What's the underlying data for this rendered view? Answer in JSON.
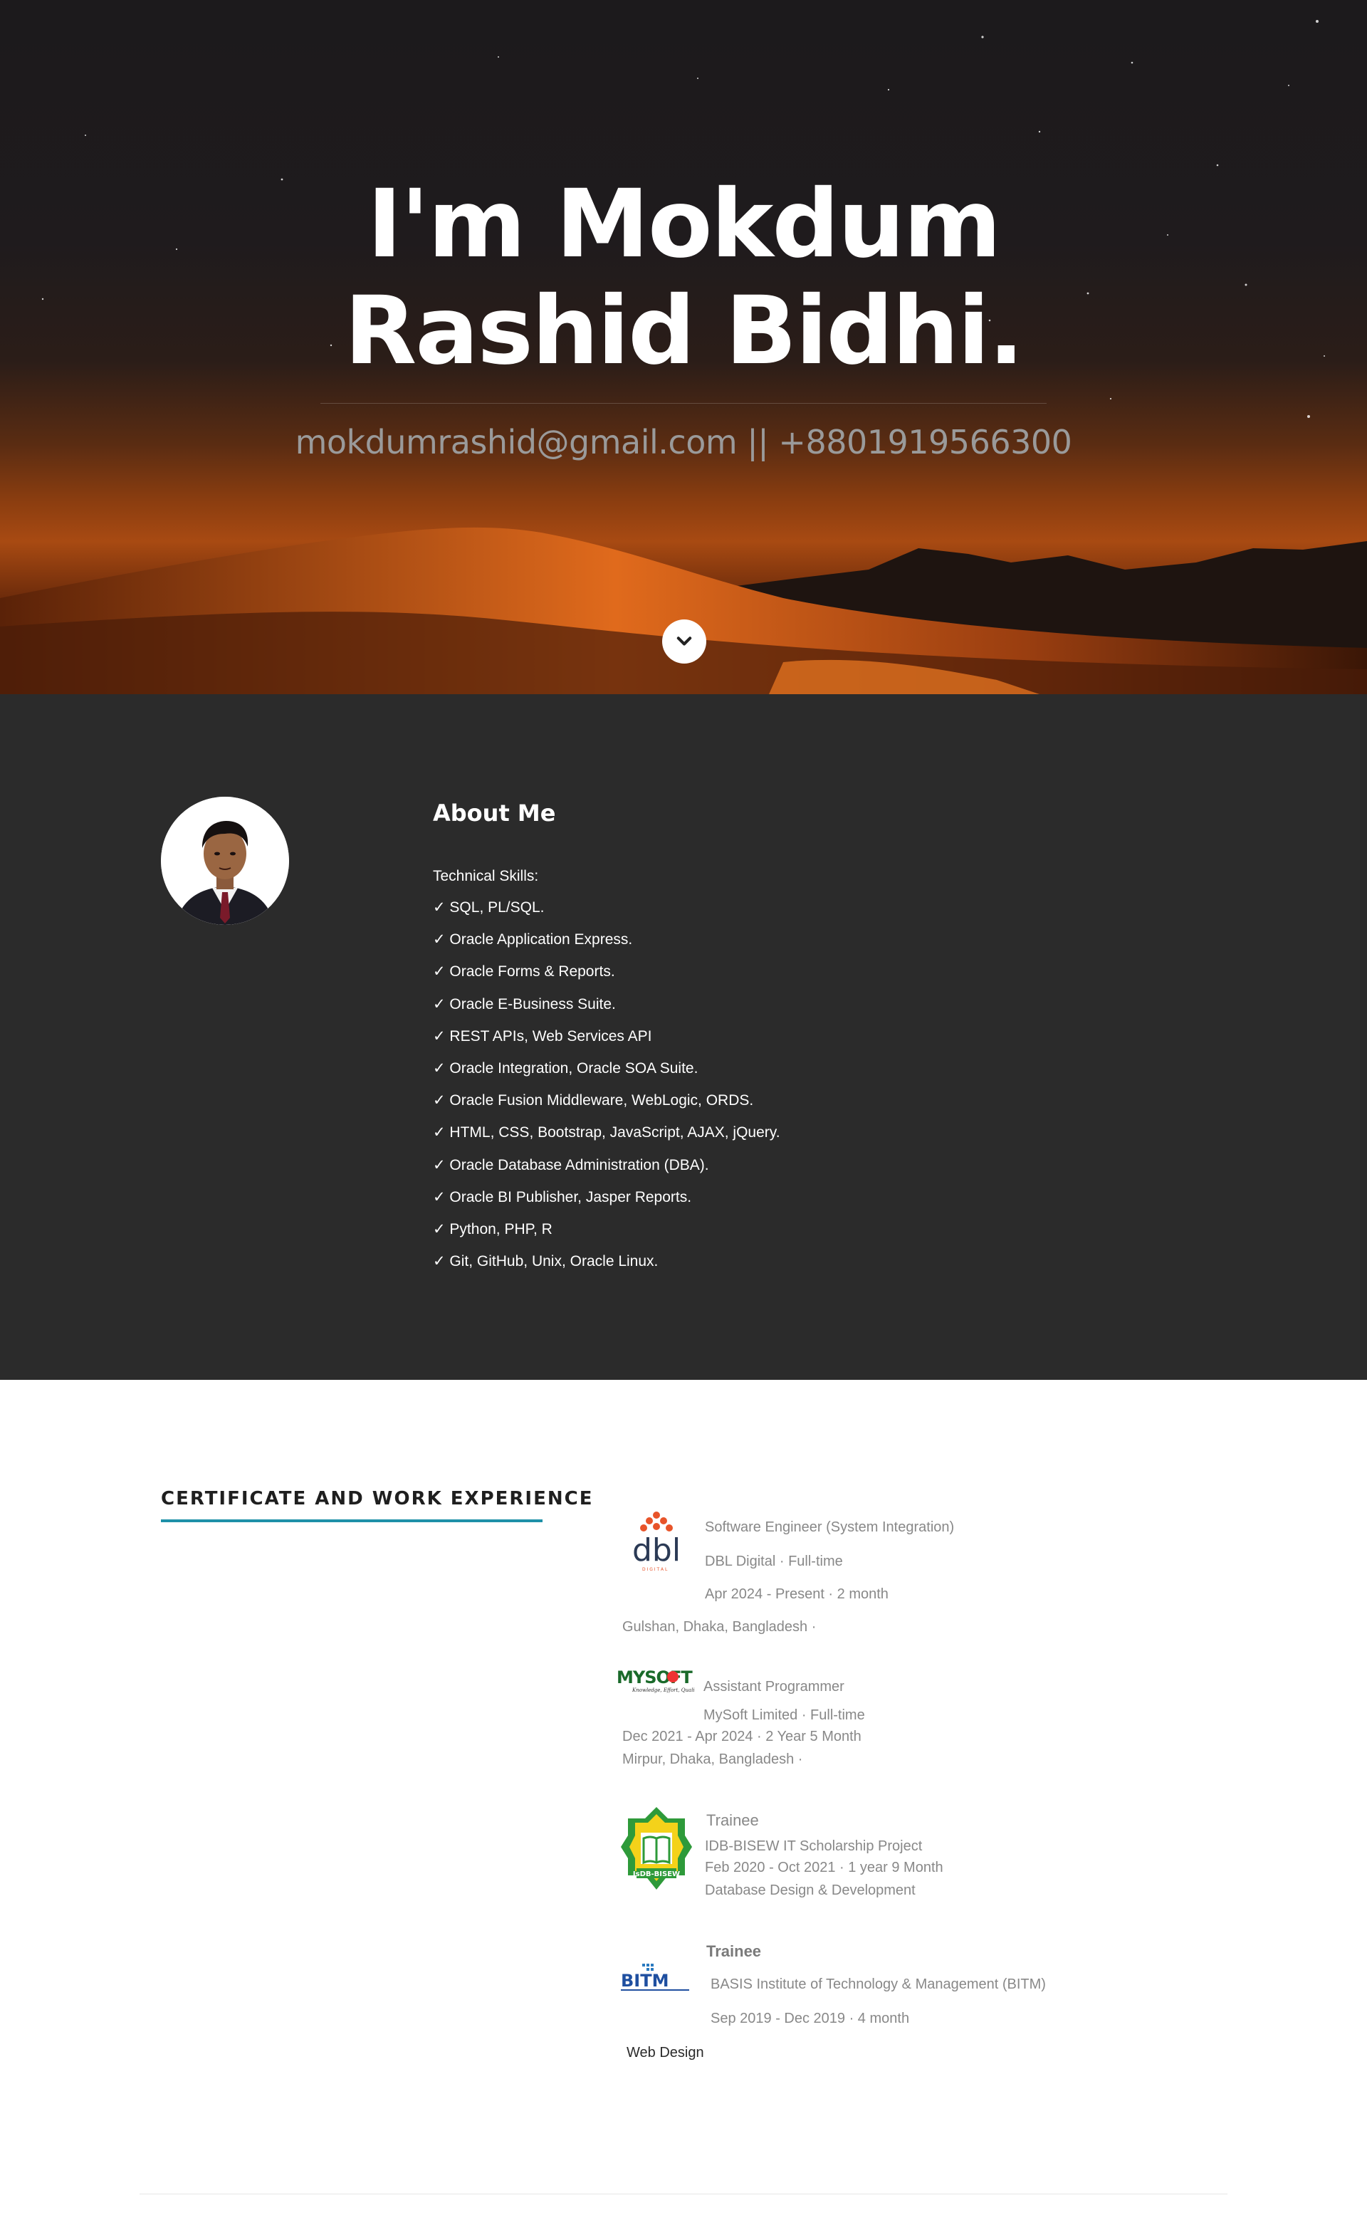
{
  "hero": {
    "title": "I'm Mokdum Rashid Bidhi.",
    "contact": "mokdumrashid@gmail.com || +8801919566300",
    "scroll_icon": "chevron-down-icon"
  },
  "about": {
    "title": "About Me",
    "skills_label": "Technical Skills:",
    "skills": [
      "✓ SQL, PL/SQL.",
      "✓ Oracle Application Express.",
      "✓ Oracle Forms & Reports.",
      "✓ Oracle E-Business Suite.",
      "✓ REST APIs, Web Services API",
      "✓ Oracle Integration, Oracle SOA Suite.",
      "✓ Oracle Fusion Middleware, WebLogic, ORDS.",
      "✓ HTML, CSS, Bootstrap, JavaScript, AJAX, jQuery.",
      "✓ Oracle Database Administration (DBA).",
      "✓ Oracle BI Publisher, Jasper Reports.",
      "✓ Python, PHP, R",
      "✓ Git, GitHub, Unix, Oracle Linux."
    ]
  },
  "experience": {
    "heading": "CERTIFICATE AND WORK EXPERIENCE",
    "jobs": [
      {
        "logo": "dbl",
        "logo_sub": "D I G I T A L",
        "title": "Software Engineer (System Integration)",
        "company": "DBL Digital · Full-time",
        "period": "Apr 2024 - Present · 2 month",
        "location": "Gulshan, Dhaka, Bangladesh ·"
      },
      {
        "logo": "MYSOFT",
        "logo_sub": "Knowledge, Effort, Quality",
        "title": "Assistant Programmer",
        "company": "MySoft Limited · Full-time",
        "period": "Dec 2021 - Apr 2024 · 2 Year 5 Month",
        "location": "Mirpur, Dhaka, Bangladesh ·"
      },
      {
        "logo": "IsDB-BISEW",
        "title": "Trainee",
        "company": "IDB-BISEW IT Scholarship Project",
        "period": "Feb 2020 - Oct 2021 · 1 year 9 Month",
        "detail": "Database Design & Development"
      },
      {
        "logo": "BITM",
        "title": "Trainee",
        "company": "BASIS Institute of Technology & Management (BITM)",
        "period": "Sep 2019 - Dec 2019 · 4 month",
        "detail": "Web Design"
      }
    ]
  }
}
